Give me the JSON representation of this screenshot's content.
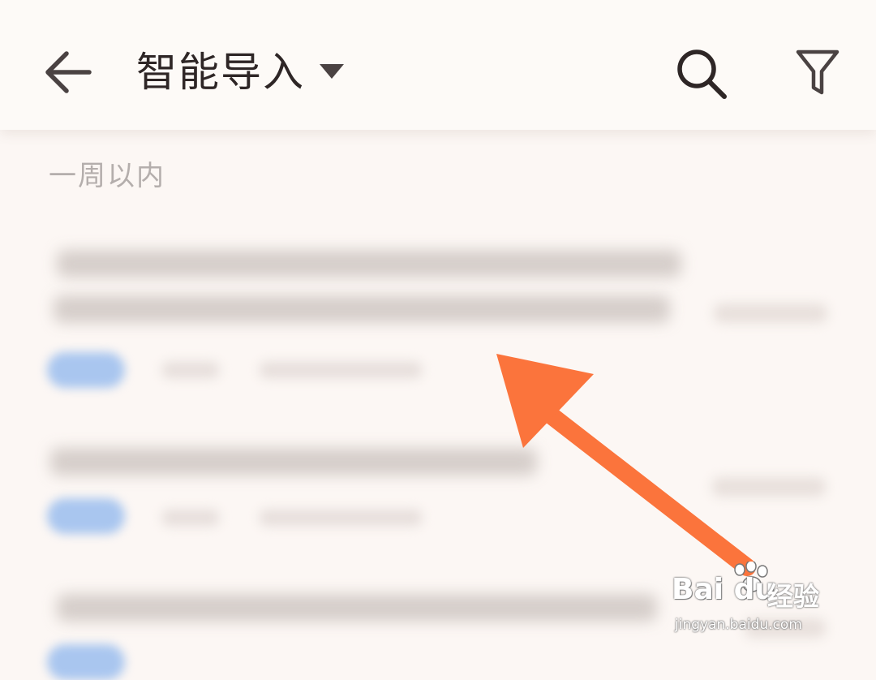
{
  "header": {
    "title": "智能导入",
    "back_icon": "arrow-left-icon",
    "dropdown_icon": "caret-down-icon",
    "search_icon": "search-icon",
    "filter_icon": "funnel-filter-icon"
  },
  "list": {
    "section_header": "一周以内",
    "items": [
      {
        "title": "",
        "tag": "",
        "date": ""
      },
      {
        "title": "",
        "tag": "",
        "date": ""
      },
      {
        "title": "",
        "tag": "",
        "date": ""
      }
    ]
  },
  "annotation": {
    "arrow_color": "#fb743c"
  },
  "watermark": {
    "brand": "Bai du",
    "cn": "经验",
    "url": "jingyan.baidu.com"
  },
  "colors": {
    "background": "#fcf7f4",
    "title_text": "#2e2626",
    "section_header_text": "#b4aeac",
    "tag_blue": "#a9c6ef"
  }
}
